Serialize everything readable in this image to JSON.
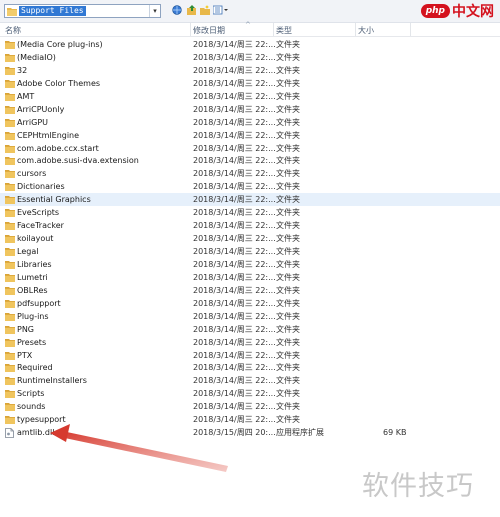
{
  "toolbar": {
    "address": "Support Files",
    "logo_php": "php",
    "logo_cn": "中文网"
  },
  "columns": {
    "name": "名称",
    "date": "修改日期",
    "type": "类型",
    "size": "大小"
  },
  "rows": [
    {
      "name": "(Media Core plug-ins)",
      "date": "2018/3/14/周三 22:...",
      "type": "文件夹",
      "size": "",
      "kind": "folder"
    },
    {
      "name": "(MediaIO)",
      "date": "2018/3/14/周三 22:...",
      "type": "文件夹",
      "size": "",
      "kind": "folder"
    },
    {
      "name": "32",
      "date": "2018/3/14/周三 22:...",
      "type": "文件夹",
      "size": "",
      "kind": "folder"
    },
    {
      "name": "Adobe Color Themes",
      "date": "2018/3/14/周三 22:...",
      "type": "文件夹",
      "size": "",
      "kind": "folder"
    },
    {
      "name": "AMT",
      "date": "2018/3/14/周三 22:...",
      "type": "文件夹",
      "size": "",
      "kind": "folder"
    },
    {
      "name": "ArriCPUonly",
      "date": "2018/3/14/周三 22:...",
      "type": "文件夹",
      "size": "",
      "kind": "folder"
    },
    {
      "name": "ArriGPU",
      "date": "2018/3/14/周三 22:...",
      "type": "文件夹",
      "size": "",
      "kind": "folder"
    },
    {
      "name": "CEPHtmlEngine",
      "date": "2018/3/14/周三 22:...",
      "type": "文件夹",
      "size": "",
      "kind": "folder"
    },
    {
      "name": "com.adobe.ccx.start",
      "date": "2018/3/14/周三 22:...",
      "type": "文件夹",
      "size": "",
      "kind": "folder"
    },
    {
      "name": "com.adobe.susi-dva.extension",
      "date": "2018/3/14/周三 22:...",
      "type": "文件夹",
      "size": "",
      "kind": "folder"
    },
    {
      "name": "cursors",
      "date": "2018/3/14/周三 22:...",
      "type": "文件夹",
      "size": "",
      "kind": "folder"
    },
    {
      "name": "Dictionaries",
      "date": "2018/3/14/周三 22:...",
      "type": "文件夹",
      "size": "",
      "kind": "folder"
    },
    {
      "name": "Essential Graphics",
      "date": "2018/3/14/周三 22:...",
      "type": "文件夹",
      "size": "",
      "kind": "folder"
    },
    {
      "name": "EveScripts",
      "date": "2018/3/14/周三 22:...",
      "type": "文件夹",
      "size": "",
      "kind": "folder"
    },
    {
      "name": "FaceTracker",
      "date": "2018/3/14/周三 22:...",
      "type": "文件夹",
      "size": "",
      "kind": "folder"
    },
    {
      "name": "koilayout",
      "date": "2018/3/14/周三 22:...",
      "type": "文件夹",
      "size": "",
      "kind": "folder"
    },
    {
      "name": "Legal",
      "date": "2018/3/14/周三 22:...",
      "type": "文件夹",
      "size": "",
      "kind": "folder"
    },
    {
      "name": "Libraries",
      "date": "2018/3/14/周三 22:...",
      "type": "文件夹",
      "size": "",
      "kind": "folder"
    },
    {
      "name": "Lumetri",
      "date": "2018/3/14/周三 22:...",
      "type": "文件夹",
      "size": "",
      "kind": "folder"
    },
    {
      "name": "OBLRes",
      "date": "2018/3/14/周三 22:...",
      "type": "文件夹",
      "size": "",
      "kind": "folder"
    },
    {
      "name": "pdfsupport",
      "date": "2018/3/14/周三 22:...",
      "type": "文件夹",
      "size": "",
      "kind": "folder"
    },
    {
      "name": "Plug-ins",
      "date": "2018/3/14/周三 22:...",
      "type": "文件夹",
      "size": "",
      "kind": "folder"
    },
    {
      "name": "PNG",
      "date": "2018/3/14/周三 22:...",
      "type": "文件夹",
      "size": "",
      "kind": "folder"
    },
    {
      "name": "Presets",
      "date": "2018/3/14/周三 22:...",
      "type": "文件夹",
      "size": "",
      "kind": "folder"
    },
    {
      "name": "PTX",
      "date": "2018/3/14/周三 22:...",
      "type": "文件夹",
      "size": "",
      "kind": "folder"
    },
    {
      "name": "Required",
      "date": "2018/3/14/周三 22:...",
      "type": "文件夹",
      "size": "",
      "kind": "folder"
    },
    {
      "name": "RuntimeInstallers",
      "date": "2018/3/14/周三 22:...",
      "type": "文件夹",
      "size": "",
      "kind": "folder"
    },
    {
      "name": "Scripts",
      "date": "2018/3/14/周三 22:...",
      "type": "文件夹",
      "size": "",
      "kind": "folder"
    },
    {
      "name": "sounds",
      "date": "2018/3/14/周三 22:...",
      "type": "文件夹",
      "size": "",
      "kind": "folder"
    },
    {
      "name": "typesupport",
      "date": "2018/3/14/周三 22:...",
      "type": "文件夹",
      "size": "",
      "kind": "folder"
    },
    {
      "name": "amtlib.dll",
      "date": "2018/3/15/周四 20:...",
      "type": "应用程序扩展",
      "size": "69 KB",
      "kind": "file"
    }
  ],
  "selected_row_name": "Essential Graphics",
  "watermark": "软件技巧",
  "colors": {
    "folder": "#e8b84a",
    "selection": "#e6f0fb",
    "arrow": "#d9453a",
    "logo_red": "#d4121e"
  }
}
